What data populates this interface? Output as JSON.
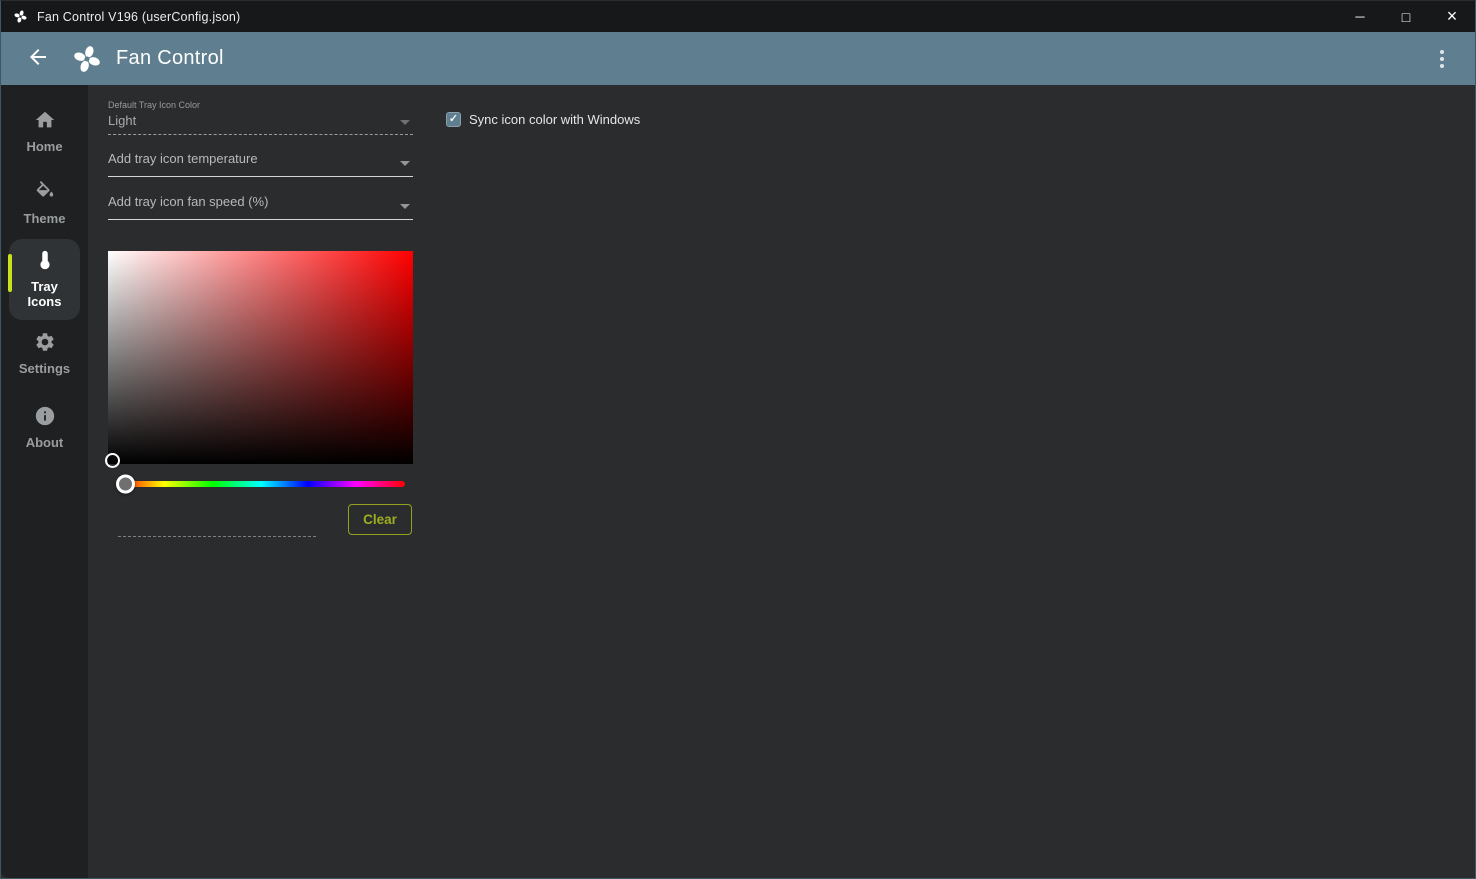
{
  "titlebar": {
    "title": "Fan Control V196 (userConfig.json)",
    "controls": {
      "minimize": "─",
      "maximize": "□",
      "close": "×"
    }
  },
  "header": {
    "title": "Fan Control",
    "icons": {
      "back": "arrow-left",
      "logo": "fan",
      "menu": "kebab-vertical"
    }
  },
  "sidebar": {
    "items": [
      {
        "label": "Home",
        "icon": "home-icon",
        "selected": false
      },
      {
        "label": "Theme",
        "icon": "paint-bucket-icon",
        "selected": false
      },
      {
        "label": "Tray Icons",
        "icon": "thermometer-icon",
        "selected": true
      },
      {
        "label": "Settings",
        "icon": "gear-icon",
        "selected": false
      },
      {
        "label": "About",
        "icon": "info-icon",
        "selected": false
      }
    ]
  },
  "main": {
    "default_tray_icon_color": {
      "label": "Default Tray Icon Color",
      "value": "Light",
      "disabled": true
    },
    "temperature_dropdown": {
      "placeholder": "Add tray icon temperature"
    },
    "fan_speed_dropdown": {
      "placeholder": "Add tray icon fan speed (%)"
    },
    "color_picker": {
      "selected_hue": "#ff0000",
      "cursor_position": "bottom-left",
      "hue_thumb_position": "left"
    },
    "clear_button_label": "Clear",
    "sync_checkbox": {
      "label": "Sync icon color with Windows",
      "checked": true,
      "check_glyph": "✓"
    }
  },
  "colors": {
    "titlebar_bg": "#171819",
    "header_bg": "#5f7e8f",
    "sidebar_bg": "#1e2021",
    "content_bg": "#2a2c2d",
    "selected_nav_bg": "#2f3335",
    "accent_indicator": "#c9e11c",
    "clear_button": "#9fad20",
    "checkbox_fill": "#5f7e8f"
  }
}
